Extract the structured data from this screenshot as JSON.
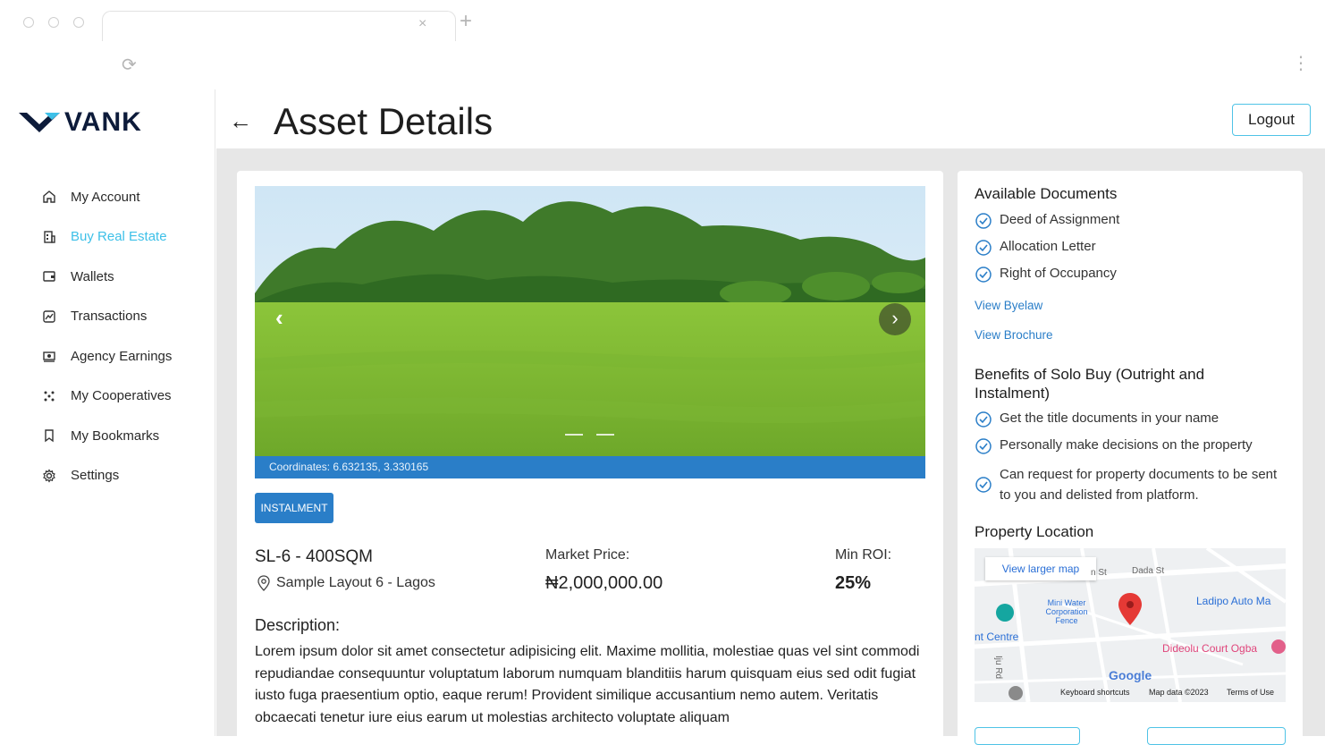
{
  "browser": {
    "tab_close": "×",
    "tab_new": "+",
    "reload": "⟳",
    "menu": "⋮"
  },
  "brand": {
    "name": "VANK",
    "color": "#0d1b3a"
  },
  "sidebar": {
    "items": [
      {
        "label": "My Account",
        "icon": "home-icon"
      },
      {
        "label": "Buy Real Estate",
        "icon": "building-icon",
        "active": true
      },
      {
        "label": "Wallets",
        "icon": "wallet-icon"
      },
      {
        "label": "Transactions",
        "icon": "transactions-icon"
      },
      {
        "label": "Agency Earnings",
        "icon": "earnings-icon"
      },
      {
        "label": "My Cooperatives",
        "icon": "cooperatives-icon"
      },
      {
        "label": "My Bookmarks",
        "icon": "bookmark-icon"
      },
      {
        "label": "Settings",
        "icon": "gear-icon"
      }
    ],
    "active_color": "#3ec0e8"
  },
  "header": {
    "title": "Asset Details",
    "logout_label": "Logout",
    "back": "←"
  },
  "asset": {
    "coordinates": "Coordinates: 6.632135, 3.330165",
    "badge": "INSTALMENT",
    "name": "SL-6 - 400SQM",
    "location": "Sample Layout 6 - Lagos",
    "price_label": "Market Price:",
    "price_value": "₦2,000,000.00",
    "roi_label": "Min ROI:",
    "roi_value": "25%",
    "description_title": "Description:",
    "description": "Lorem ipsum dolor sit amet consectetur adipisicing elit. Maxime mollitia, molestiae quas vel sint commodi repudiandae consequuntur voluptatum laborum numquam blanditiis harum quisquam eius sed odit fugiat iusto fuga praesentium optio, eaque rerum! Provident similique accusantium nemo autem. Veritatis obcaecati tenetur iure eius earum ut molestias architecto voluptate aliquam",
    "carousel_prev": "‹",
    "carousel_next": "›"
  },
  "documents": {
    "title": "Available Documents",
    "items": [
      "Deed of Assignment",
      "Allocation Letter",
      "Right of Occupancy"
    ],
    "view_byelaw": "View Byelaw",
    "view_brochure": "View Brochure"
  },
  "benefits": {
    "title": "Benefits of Solo Buy (Outright and Instalment)",
    "items": [
      "Get the title documents in your name",
      "Personally make decisions on the property",
      "Can request for property documents to be sent to you and delisted from platform."
    ]
  },
  "location": {
    "title": "Property Location",
    "view_larger": "View larger map",
    "labels": {
      "dada_st": "Dada St",
      "ladipo": "Ladipo Auto Ma",
      "mini_water": "Mini Water Corporation Fence",
      "nt_centre": "nt Centre",
      "dideolu": "Dideolu Court Ogba",
      "google": "Google",
      "keyboard": "Keyboard shortcuts",
      "map_data": "Map data ©2023",
      "terms": "Terms of Use",
      "n_st": "n St",
      "ijiu_rd": "Iju Rd"
    }
  },
  "colors": {
    "accent": "#2a7ec8",
    "outline": "#4fc3e6",
    "background": "#e7e7e7"
  }
}
